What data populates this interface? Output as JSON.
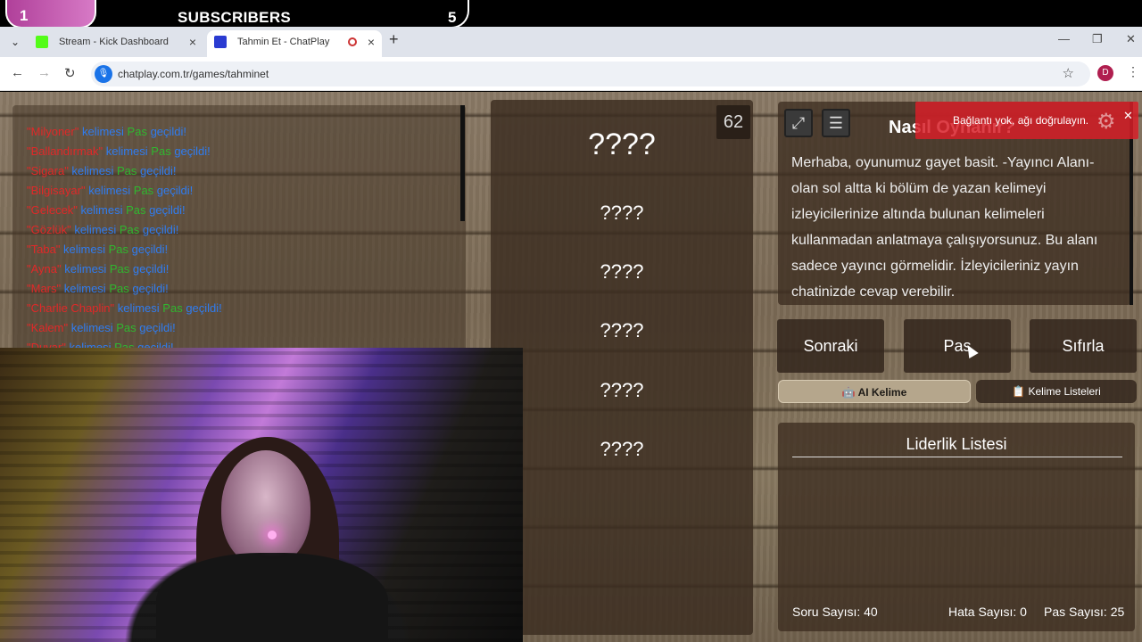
{
  "overlay": {
    "left_count": "1",
    "title": "SUBSCRIBERS",
    "right_count": "5"
  },
  "browser": {
    "tabs": [
      {
        "title": "Stream - Kick Dashboard",
        "favicon_color": "#53fc18"
      },
      {
        "title": "Tahmin Et - ChatPlay",
        "favicon_color": "#2a3bd1",
        "recording": true
      }
    ],
    "url": "chatplay.com.tr/games/tahminet",
    "profile_initial": "D"
  },
  "chat": {
    "lines": [
      {
        "word": "\"Milyoner\"",
        "mid": " kelimesi ",
        "pas": "Pas",
        "end": " geçildi!"
      },
      {
        "word": "\"Ballandırmak\"",
        "mid": " kelimesi ",
        "pas": "Pas",
        "end": " geçildi!"
      },
      {
        "word": "\"Sigara\"",
        "mid": " kelimesi ",
        "pas": "Pas",
        "end": " geçildi!"
      },
      {
        "word": "\"Bilgisayar\"",
        "mid": " kelimesi ",
        "pas": "Pas",
        "end": " geçildi!"
      },
      {
        "word": "\"Gelecek\"",
        "mid": " kelimesi ",
        "pas": "Pas",
        "end": " geçildi!"
      },
      {
        "word": "\"Gözlük\"",
        "mid": " kelimesi ",
        "pas": "Pas",
        "end": " geçildi!"
      },
      {
        "word": "\"Taba\"",
        "mid": " kelimesi ",
        "pas": "Pas",
        "end": " geçildi!"
      },
      {
        "word": "\"Ayna\"",
        "mid": " kelimesi ",
        "pas": "Pas",
        "end": " geçildi!"
      },
      {
        "word": "\"Mars\"",
        "mid": " kelimesi ",
        "pas": "Pas",
        "end": " geçildi!"
      },
      {
        "word": "\"Charlie Chaplin\"",
        "mid": " kelimesi ",
        "pas": "Pas",
        "end": " geçildi!"
      },
      {
        "word": "\"Kalem\"",
        "mid": " kelimesi ",
        "pas": "Pas",
        "end": " geçildi!"
      },
      {
        "word": "\"Duvar\"",
        "mid": " kelimesi ",
        "pas": "Pas",
        "end": " geçildi!"
      }
    ]
  },
  "game": {
    "timer": "62",
    "main_word": "????",
    "hidden_words": [
      "????",
      "????",
      "????",
      "????",
      "????"
    ]
  },
  "howto": {
    "title": "Nasıl Oynanır?",
    "text": "Merhaba, oyunumuz gayet basit. -Yayıncı Alanı- olan sol altta ki bölüm de yazan kelimeyi izleyicilerinize altında bulunan kelimeleri kullanmadan anlatmaya çalışıyorsunuz. Bu alanı sadece yayıncı görmelidir. İzleyicileriniz yayın chatinizde cevap verebilir."
  },
  "toast": {
    "message": "Bağlantı yok, ağı doğrulayın."
  },
  "controls": {
    "next": "Sonraki",
    "pass": "Pas",
    "reset": "Sıfırla",
    "ai_word": "🤖 AI Kelime",
    "word_lists": "📋 Kelime Listeleri"
  },
  "leaderboard": {
    "title": "Liderlik Listesi",
    "question_count": "Soru Sayısı: 40",
    "error_count": "Hata Sayısı: 0",
    "pass_count": "Pas Sayısı: 25"
  }
}
